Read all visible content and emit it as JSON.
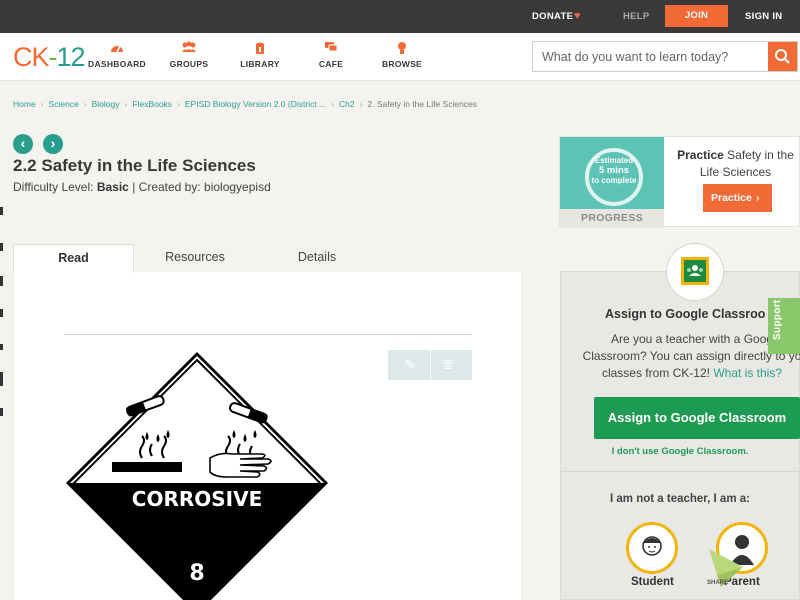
{
  "topbar": {
    "donate": "DONATE",
    "help": "HELP",
    "join": "JOIN",
    "signin": "SIGN IN"
  },
  "nav": {
    "logo": {
      "ck": "CK",
      "dash": "-",
      "num": "12"
    },
    "items": [
      {
        "label": "DASHBOARD",
        "icon": "dashboard-icon"
      },
      {
        "label": "GROUPS",
        "icon": "groups-icon"
      },
      {
        "label": "LIBRARY",
        "icon": "library-icon"
      },
      {
        "label": "CAFE",
        "icon": "cafe-icon"
      },
      {
        "label": "BROWSE",
        "icon": "browse-icon"
      }
    ],
    "search_placeholder": "What do you want to learn today?"
  },
  "breadcrumb": {
    "items": [
      "Home",
      "Science",
      "Biology",
      "FlexBooks",
      "EPISD Biology Version 2.0 (District ...",
      "Ch2"
    ],
    "current": "2. Safety in the Life Sciences"
  },
  "article": {
    "title": "2.2 Safety in the Life Sciences",
    "difficulty_label": "Difficulty Level:",
    "difficulty": "Basic",
    "created_by": "| Created by: biologyepisd"
  },
  "tabs": [
    "Read",
    "Resources",
    "Details"
  ],
  "placard": {
    "label": "CORROSIVE",
    "class_number": "8"
  },
  "practice": {
    "estimate_line1": "Estimated",
    "estimate_line2": "5 mins",
    "estimate_line3": "to complete",
    "badge": "PROGRESS",
    "title_bold": "Practice",
    "title_rest": "Safety in the Life Sciences",
    "button": "Practice"
  },
  "assign": {
    "title": "Assign to Google Classroo",
    "desc_line1": "Are you a teacher with a Goog",
    "desc_line2": "Classroom? You can assign directly to yo",
    "desc_line3": "classes from CK-12!",
    "what": "What is this?",
    "button": "Assign to Google Classroom",
    "no_gc": "I don't use Google Classroom.",
    "not_teacher": "I am not a teacher, I am a:",
    "roles": [
      "Student",
      "Parent"
    ]
  },
  "support": "Support",
  "share": "SHARE"
}
